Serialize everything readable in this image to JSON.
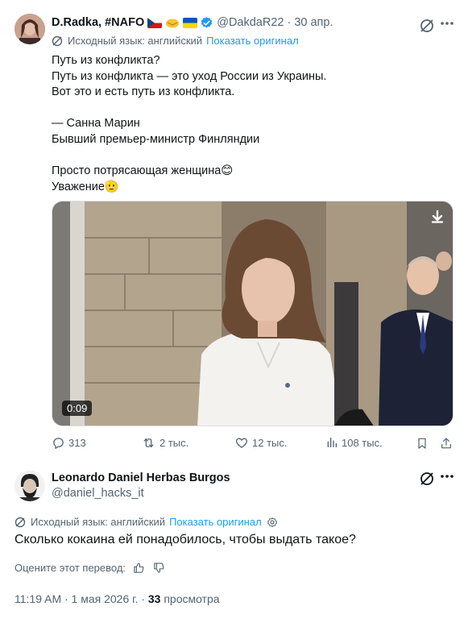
{
  "tweet": {
    "author_name": "D.Radka, #NAFO",
    "handle": "@DakdaR22",
    "date_sep": "·",
    "date": "30 апр.",
    "translated_label": "Исходный язык: английский",
    "show_original": "Показать оригинал",
    "text": "Путь из конфликта?\nПуть из конфликта — это уход России из Украины.\nВот это и есть путь из конфликта.\n\n— Санна Марин\nБывший премьер-министр Финляндии\n\nПросто потрясающая женщина😊\nУважение🫡",
    "video_duration": "0:09",
    "actions": {
      "replies": "313",
      "reposts": "2 тыс.",
      "likes": "12 тыс.",
      "views": "108 тыс."
    },
    "colors": {
      "accent": "#1d9bf0",
      "muted": "#536471"
    }
  },
  "reply": {
    "author_name": "Leonardo Daniel Herbas Burgos",
    "handle": "@daniel_hacks_it",
    "translated_label": "Исходный язык: английский",
    "show_original": "Показать оригинал",
    "text": "Сколько кокаина ей понадобилось, чтобы выдать такое?",
    "rate_label": "Оцените этот перевод:",
    "timestamp": "11:19 AM · 1 мая 2026 г. ·",
    "views_count": "33",
    "views_label": "просмотра"
  }
}
